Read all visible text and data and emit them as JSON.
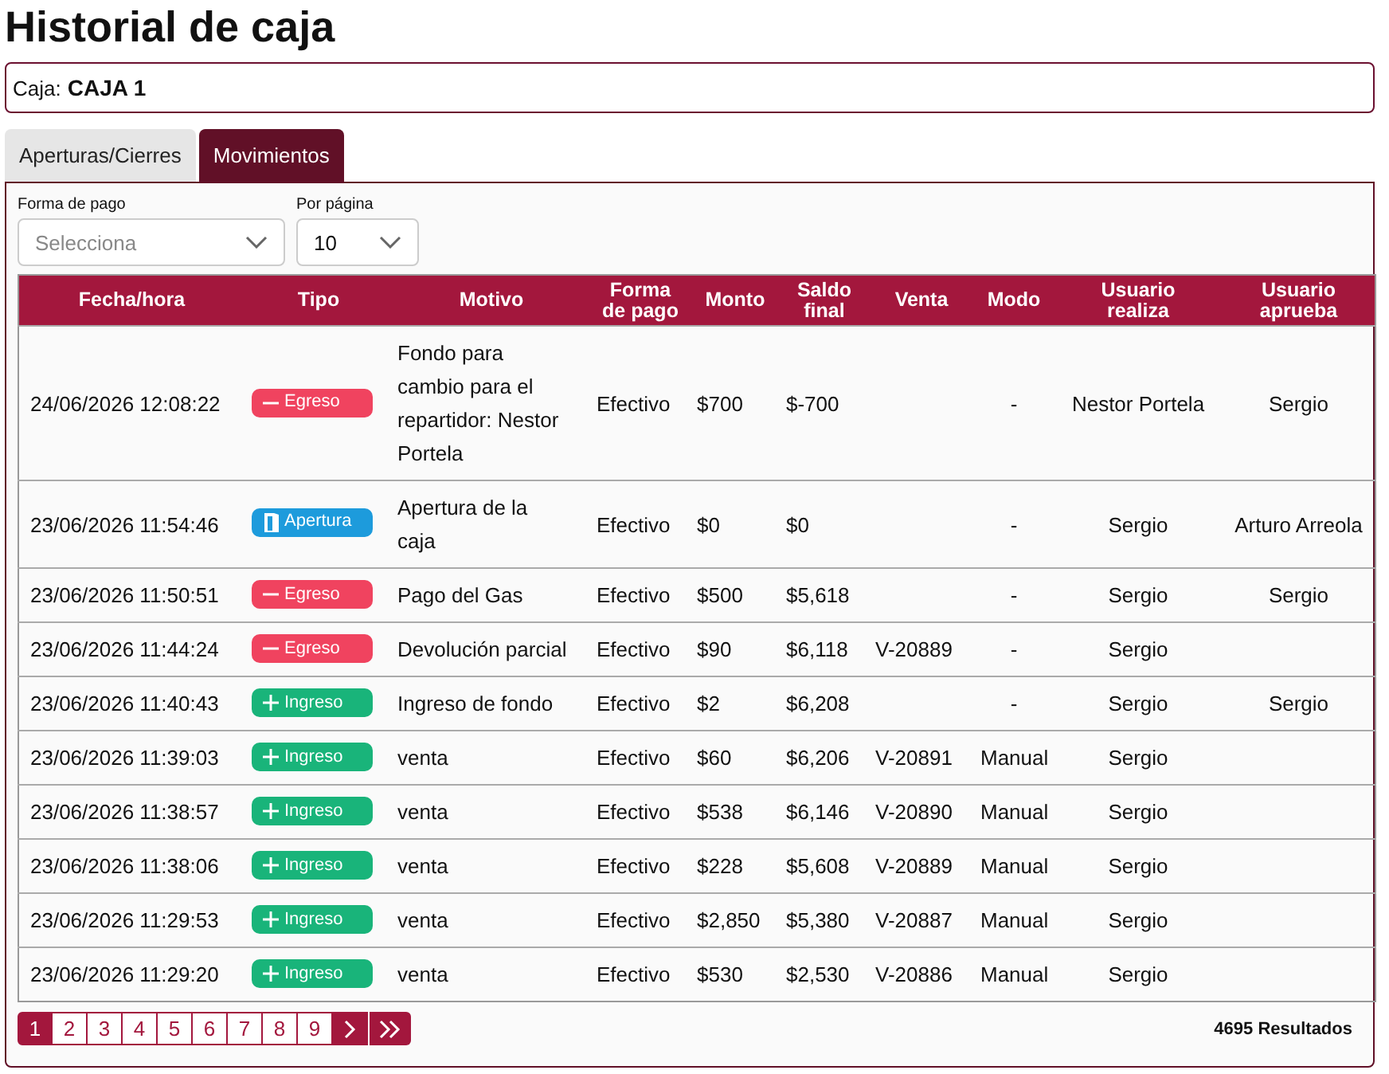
{
  "title": "Historial de caja",
  "caja": {
    "label": "Caja:",
    "value": "CAJA 1"
  },
  "tabs": [
    {
      "label": "Aperturas/Cierres",
      "selected": false
    },
    {
      "label": "Movimientos",
      "selected": true
    }
  ],
  "filters": [
    {
      "label": "Forma de pago",
      "placeholder": "Selecciona",
      "kind": "wide"
    },
    {
      "label": "Por página",
      "value": "10",
      "kind": "narrow"
    }
  ],
  "table": {
    "columns": [
      "Fecha/hora",
      "Tipo",
      "Motivo",
      "Forma de pago",
      "Monto",
      "Saldo final",
      "Venta",
      "Modo",
      "Usuario realiza",
      "Usuario aprueba"
    ],
    "rows": [
      {
        "fecha": "24/06/2026 12:08:22",
        "tipo": {
          "kind": "egreso",
          "label": "Egreso"
        },
        "motivo": "Fondo para cambio para el repartidor: Nestor Portela",
        "forma": "Efectivo",
        "monto": "$700",
        "saldo": "$-700",
        "modo": "-",
        "realiza": "Nestor Portela",
        "aprueba": "Sergio"
      },
      {
        "fecha": "23/06/2026 11:54:46",
        "tipo": {
          "kind": "apertura",
          "label": "Apertura"
        },
        "motivo": "Apertura de la caja",
        "forma": "Efectivo",
        "monto": "$0",
        "saldo": "$0",
        "modo": "-",
        "realiza": "Sergio",
        "aprueba": "Arturo Arreola"
      },
      {
        "fecha": "23/06/2026 11:50:51",
        "tipo": {
          "kind": "egreso",
          "label": "Egreso"
        },
        "motivo": "Pago del Gas",
        "forma": "Efectivo",
        "monto": "$500",
        "saldo": "$5,618",
        "modo": "-",
        "realiza": "Sergio",
        "aprueba": "Sergio"
      },
      {
        "fecha": "23/06/2026 11:44:24",
        "tipo": {
          "kind": "egreso",
          "label": "Egreso"
        },
        "motivo": "Devolución parcial",
        "forma": "Efectivo",
        "monto": "$90",
        "saldo": "$6,118",
        "venta": "V-20889",
        "modo": "-",
        "realiza": "Sergio"
      },
      {
        "fecha": "23/06/2026 11:40:43",
        "tipo": {
          "kind": "ingreso",
          "label": "Ingreso"
        },
        "motivo": "Ingreso de fondo",
        "forma": "Efectivo",
        "monto": "$2",
        "saldo": "$6,208",
        "modo": "-",
        "realiza": "Sergio",
        "aprueba": "Sergio"
      },
      {
        "fecha": "23/06/2026 11:39:03",
        "tipo": {
          "kind": "ingreso",
          "label": "Ingreso"
        },
        "motivo": "venta",
        "forma": "Efectivo",
        "monto": "$60",
        "saldo": "$6,206",
        "venta": "V-20891",
        "modo": "Manual",
        "realiza": "Sergio"
      },
      {
        "fecha": "23/06/2026 11:38:57",
        "tipo": {
          "kind": "ingreso",
          "label": "Ingreso"
        },
        "motivo": "venta",
        "forma": "Efectivo",
        "monto": "$538",
        "saldo": "$6,146",
        "venta": "V-20890",
        "modo": "Manual",
        "realiza": "Sergio"
      },
      {
        "fecha": "23/06/2026 11:38:06",
        "tipo": {
          "kind": "ingreso",
          "label": "Ingreso"
        },
        "motivo": "venta",
        "forma": "Efectivo",
        "monto": "$228",
        "saldo": "$5,608",
        "venta": "V-20889",
        "modo": "Manual",
        "realiza": "Sergio"
      },
      {
        "fecha": "23/06/2026 11:29:53",
        "tipo": {
          "kind": "ingreso",
          "label": "Ingreso"
        },
        "motivo": "venta",
        "forma": "Efectivo",
        "monto": "$2,850",
        "saldo": "$5,380",
        "venta": "V-20887",
        "modo": "Manual",
        "realiza": "Sergio"
      },
      {
        "fecha": "23/06/2026 11:29:20",
        "tipo": {
          "kind": "ingreso",
          "label": "Ingreso"
        },
        "motivo": "venta",
        "forma": "Efectivo",
        "monto": "$530",
        "saldo": "$2,530",
        "venta": "V-20886",
        "modo": "Manual",
        "realiza": "Sergio"
      }
    ]
  },
  "pagination": {
    "pages": [
      {
        "label": "1",
        "selected": true
      },
      {
        "label": "2",
        "selected": false
      },
      {
        "label": "3",
        "selected": false
      },
      {
        "label": "4",
        "selected": false
      },
      {
        "label": "5",
        "selected": false
      },
      {
        "label": "6",
        "selected": false
      },
      {
        "label": "7",
        "selected": false
      },
      {
        "label": "8",
        "selected": false
      },
      {
        "label": "9",
        "selected": false
      }
    ],
    "results": "4695 Resultados"
  }
}
